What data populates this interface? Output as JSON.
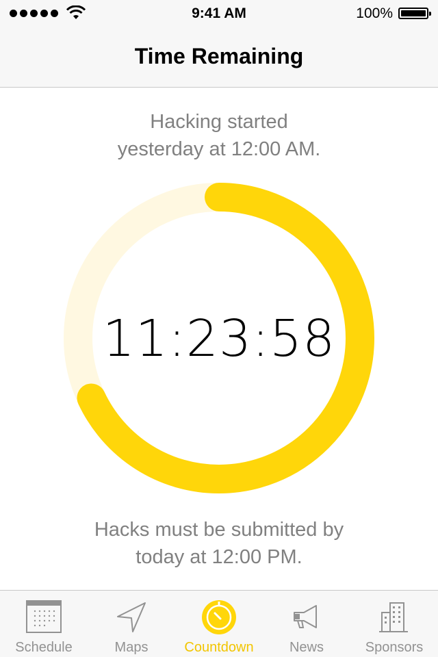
{
  "status_bar": {
    "time": "9:41 AM",
    "battery": "100%"
  },
  "nav": {
    "title": "Time Remaining"
  },
  "start": {
    "line1": "Hacking started",
    "line2": "yesterday at 12:00 AM."
  },
  "countdown": {
    "value": "11:23:58",
    "progress_remaining_fraction": 0.68
  },
  "end": {
    "line1": "Hacks must be submitted by",
    "line2": "today at 12:00 PM."
  },
  "colors": {
    "accent": "#FFD60A",
    "ring_track": "#FFF8E1",
    "tab_inactive": "#929292"
  },
  "tabs": [
    {
      "label": "Schedule",
      "icon": "calendar-icon",
      "active": false
    },
    {
      "label": "Maps",
      "icon": "location-arrow-icon",
      "active": false
    },
    {
      "label": "Countdown",
      "icon": "timer-icon",
      "active": true
    },
    {
      "label": "News",
      "icon": "megaphone-icon",
      "active": false
    },
    {
      "label": "Sponsors",
      "icon": "building-icon",
      "active": false
    }
  ]
}
